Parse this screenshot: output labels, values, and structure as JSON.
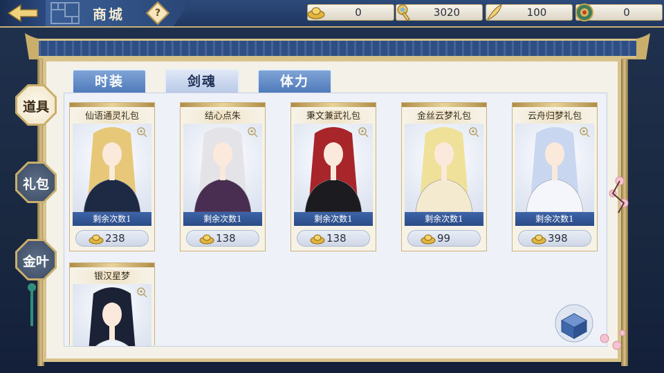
{
  "header": {
    "title": "商城",
    "help_icon": "question-diamond-icon",
    "currencies": [
      {
        "icon": "gold-ingot-icon",
        "value": "0"
      },
      {
        "icon": "jade-key-icon",
        "value": "3020"
      },
      {
        "icon": "stamina-feather-icon",
        "value": "100"
      },
      {
        "icon": "green-coin-icon",
        "value": "0"
      }
    ]
  },
  "tabs": [
    {
      "label": "时装",
      "active": false
    },
    {
      "label": "剑魂",
      "active": true
    },
    {
      "label": "体力",
      "active": false
    }
  ],
  "categories": [
    {
      "label": "道具",
      "active": true
    },
    {
      "label": "礼包",
      "active": false
    },
    {
      "label": "金叶",
      "active": false
    }
  ],
  "items": [
    {
      "name": "仙语通灵礼包",
      "remaining": "剩余次数1",
      "price": "238",
      "hair": "#e6c878",
      "robe": "#1e2a44"
    },
    {
      "name": "结心点朱",
      "remaining": "剩余次数1",
      "price": "138",
      "hair": "#e4e4e8",
      "robe": "#4a2e52"
    },
    {
      "name": "秉文兼武礼包",
      "remaining": "剩余次数1",
      "price": "138",
      "hair": "#a8262a",
      "robe": "#1c1c20"
    },
    {
      "name": "金丝云梦礼包",
      "remaining": "剩余次数1",
      "price": "99",
      "hair": "#efe09a",
      "robe": "#f4ead0"
    },
    {
      "name": "云舟归梦礼包",
      "remaining": "剩余次数1",
      "price": "398",
      "hair": "#c8d6f0",
      "robe": "#f4f6fb"
    },
    {
      "name": "银汉星梦",
      "remaining": "",
      "price": "",
      "hair": "#1c2236",
      "robe": "#eef3fa"
    }
  ],
  "colors": {
    "accent_gold": "#d9c38c",
    "panel_blue": "#2e4f86",
    "tab_blue": "#4f7bbb"
  }
}
